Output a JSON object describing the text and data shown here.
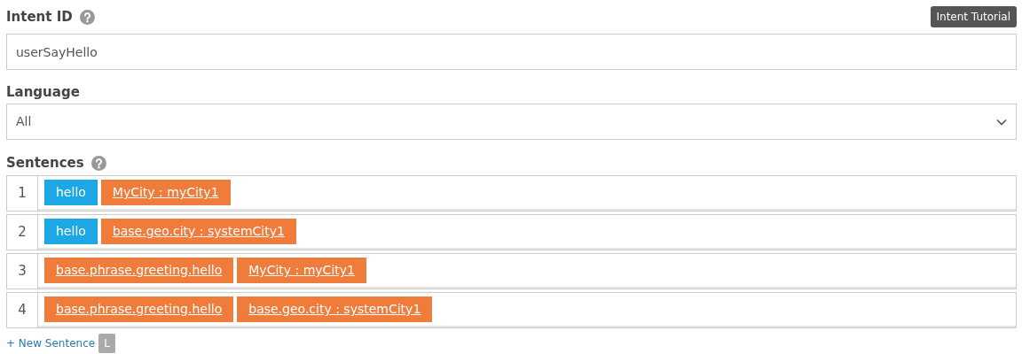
{
  "intent_id": {
    "label": "Intent ID",
    "value": "userSayHello"
  },
  "tutorial_button": "Intent Tutorial",
  "language": {
    "label": "Language",
    "value": "All"
  },
  "sentences": {
    "label": "Sentences",
    "rows": [
      {
        "number": "1",
        "tokens": [
          {
            "kind": "word",
            "text": "hello"
          },
          {
            "kind": "entity",
            "text": "MyCity : myCity1"
          }
        ]
      },
      {
        "number": "2",
        "tokens": [
          {
            "kind": "word",
            "text": "hello"
          },
          {
            "kind": "entity",
            "text": "base.geo.city : systemCity1"
          }
        ]
      },
      {
        "number": "3",
        "tokens": [
          {
            "kind": "entity",
            "text": "base.phrase.greeting.hello"
          },
          {
            "kind": "entity",
            "text": "MyCity : myCity1"
          }
        ]
      },
      {
        "number": "4",
        "tokens": [
          {
            "kind": "entity",
            "text": "base.phrase.greeting.hello"
          },
          {
            "kind": "entity",
            "text": "base.geo.city : systemCity1"
          }
        ]
      }
    ]
  },
  "new_sentence_link": "+ New Sentence",
  "shortcut_key": "L"
}
